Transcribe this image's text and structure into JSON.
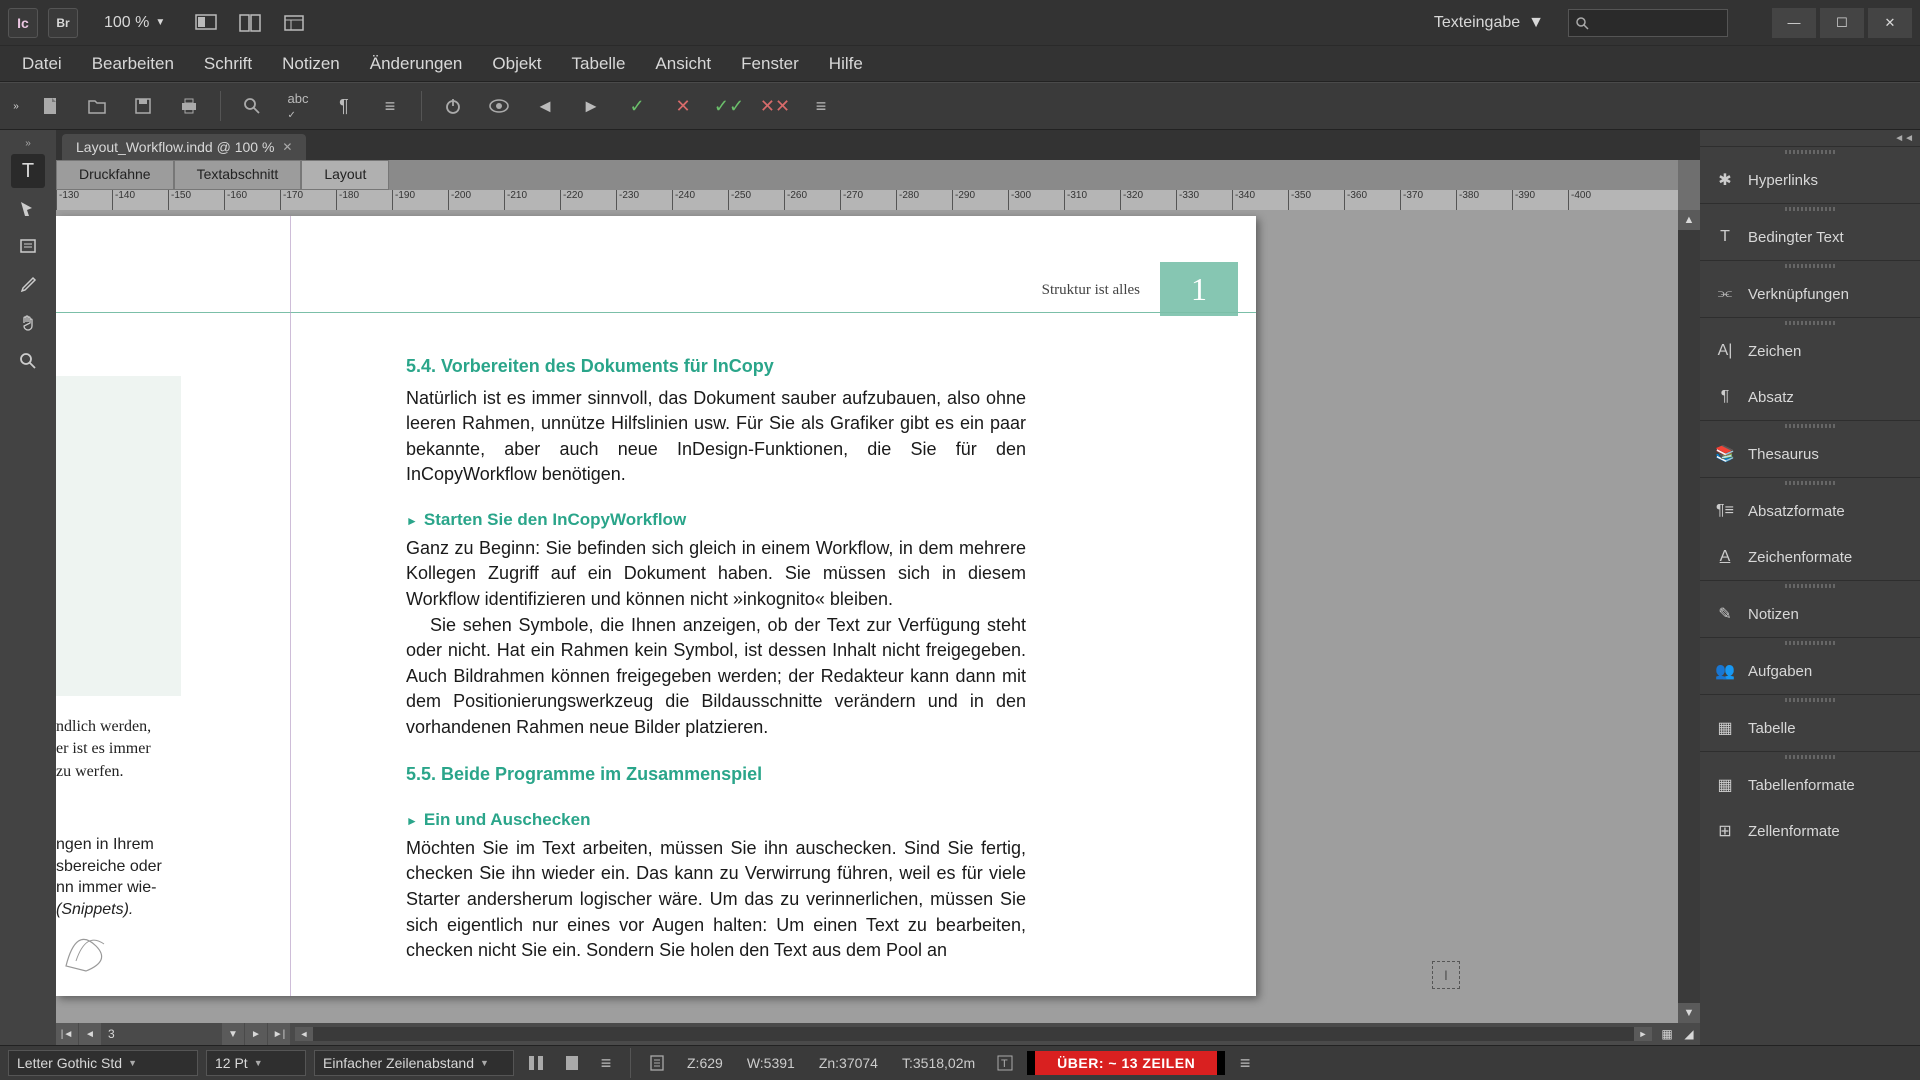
{
  "app": {
    "logo": "Ic",
    "bridge": "Br"
  },
  "zoom": "100 %",
  "workspace": "Texteingabe",
  "menu": [
    "Datei",
    "Bearbeiten",
    "Schrift",
    "Notizen",
    "Änderungen",
    "Objekt",
    "Tabelle",
    "Ansicht",
    "Fenster",
    "Hilfe"
  ],
  "doc_tab": "Layout_Workflow.indd @ 100 %",
  "view_tabs": [
    "Druckfahne",
    "Textabschnitt",
    "Layout"
  ],
  "active_view_tab": 2,
  "ruler_ticks": [
    "-130",
    "-140",
    "-150",
    "-160",
    "-170",
    "-180",
    "-190",
    "-200",
    "-210",
    "-220",
    "-230",
    "-240",
    "-250",
    "-260",
    "-270",
    "-280",
    "-290",
    "-300",
    "-310",
    "-320",
    "-330",
    "-340",
    "-350",
    "-360",
    "-370",
    "-380",
    "-390",
    "-400"
  ],
  "page": {
    "running_head": "Struktur ist alles",
    "number": "1",
    "h54": "5.4.   Vorbereiten des Dokuments für InCopy",
    "p54": "Natürlich ist es immer sinnvoll, das Dokument sauber aufzubauen, also ohne leeren Rahmen, unnütze Hilfslinien usw. Für Sie als Grafiker gibt es ein paar bekannte, aber auch neue InDesign-Funktionen, die Sie für den InCopyWorkflow benötigen.",
    "sub1": "Starten Sie den InCopyWorkflow",
    "p_sub1a": "Ganz zu Beginn: Sie befinden sich gleich in einem Workflow, in dem mehrere Kollegen Zugriff auf ein Dokument haben. Sie müssen sich in diesem Workflow identifizieren und können nicht »inkognito« bleiben.",
    "p_sub1b": "Sie sehen Symbole, die Ihnen anzeigen, ob der Text zur Verfügung steht oder nicht. Hat ein Rahmen kein Symbol, ist dessen Inhalt nicht freigegeben. Auch Bildrahmen können freigegeben werden; der Redakteur kann dann mit dem Positionierungswerkzeug die Bildausschnitte verändern und in den vorhandenen Rahmen neue Bilder platzieren.",
    "h55": "5.5.   Beide Programme im Zusammenspiel",
    "sub2": "Ein und Auschecken",
    "p_sub2": "Möchten Sie im Text arbeiten, müssen Sie ihn auschecken. Sind Sie fertig, checken Sie ihn wieder ein. Das kann zu Verwirrung führen, weil es für viele Starter andersherum logischer wäre. Um das zu verinnerlichen, müssen Sie sich eigentlich nur eines vor Augen halten: Um einen Text zu bearbeiten, checken nicht Sie ein. Sondern Sie holen den Text aus dem Pool an",
    "side1": "ndlich werden,\ner ist es immer\nzu werfen.",
    "side2a": "ngen in Ihrem\nsbereiche oder\nnn immer wie-",
    "side2b": "(Snippets)."
  },
  "page_nav_current": "3",
  "panels": {
    "g1": [
      "Hyperlinks"
    ],
    "g2": [
      "Bedingter Text"
    ],
    "g3": [
      "Verknüpfungen"
    ],
    "g4": [
      "Zeichen",
      "Absatz"
    ],
    "g5": [
      "Thesaurus"
    ],
    "g6": [
      "Absatzformate",
      "Zeichenformate"
    ],
    "g7": [
      "Notizen"
    ],
    "g8": [
      "Aufgaben"
    ],
    "g9": [
      "Tabelle"
    ],
    "g10": [
      "Tabellenformate",
      "Zellenformate"
    ]
  },
  "status": {
    "font": "Letter Gothic Std",
    "size": "12 Pt",
    "leading": "Einfacher Zeilenabstand",
    "z": "Z:629",
    "w": "W:5391",
    "zn": "Zn:37074",
    "t": "T:3518,02m",
    "overset": "ÜBER:  ~ 13 ZEILEN"
  }
}
